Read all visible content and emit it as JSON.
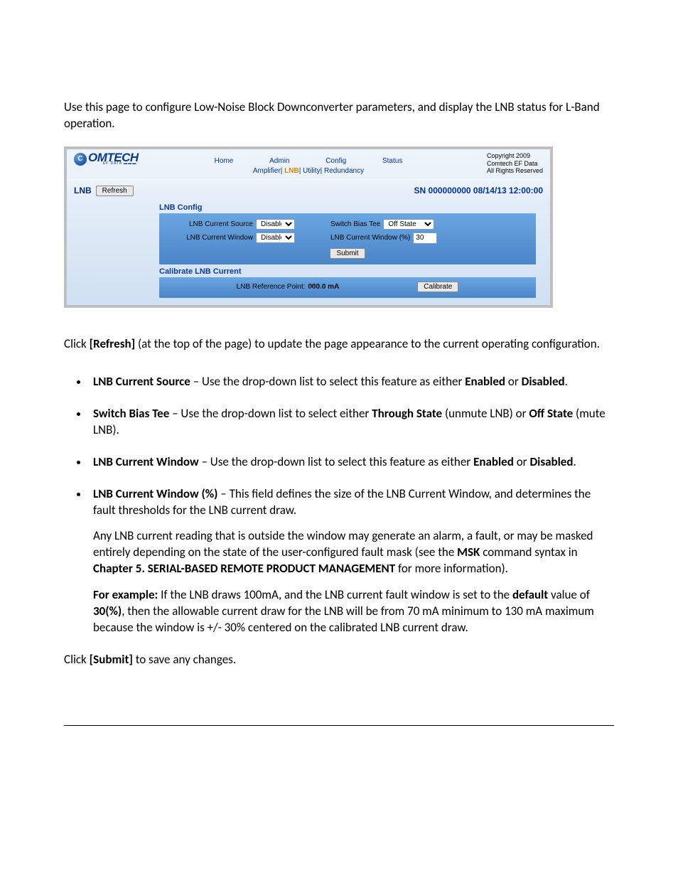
{
  "doc": {
    "intro": "Use this page to configure Low-Noise Block Downconverter parameters, and display the LNB status for L-Band operation.",
    "refresh_p1a": "Click ",
    "refresh_p1b": "[Refresh]",
    "refresh_p1c": " (at the top of the page) to update the page appearance to the current operating configuration.",
    "li1_a": "LNB Current Source",
    "li1_b": " – Use the drop-down list to select this feature as either ",
    "li1_c": "Enabled",
    "li1_d": " or ",
    "li1_e": "Disabled",
    "li2_a": "Switch Bias Tee",
    "li2_b": " – Use the drop-down list to select either ",
    "li2_c": "Through State",
    "li2_d": " (unmute LNB) or ",
    "li2_e": "Off State",
    "li2_f": " (mute LNB).",
    "li3_a": "LNB Current Window",
    "li3_b": " – Use the drop-down list to select this feature as either ",
    "li3_c": "Enabled",
    "li3_d": " or ",
    "li3_e": "Disabled",
    "li4_a": "LNB Current Window (%)",
    "li4_b": " – This field defines the size of the LNB Current Window, and determines the fault thresholds for the LNB current draw.",
    "li4_p2a": "Any LNB current reading that is outside the window may generate an alarm, a fault, or may be masked entirely depending on the state of the user-configured fault mask (see the ",
    "li4_p2b": "MSK",
    "li4_p2c": " command syntax in ",
    "li4_p2d": "Chapter 5. SERIAL-BASED REMOTE PRODUCT MANAGEMENT",
    "li4_p2e": " for more information).",
    "li4_p3a": "For example:",
    "li4_p3b": " If the LNB draws 100mA, and the LNB current fault window is set to the ",
    "li4_p3c": "default",
    "li4_p3d": " value of ",
    "li4_p3e": "30(%)",
    "li4_p3f": ", then the allowable current draw for the LNB will be from 70 mA minimum to 130 mA maximum because the window is +/- 30% centered on the calibrated LNB current draw.",
    "submit_a": "Click ",
    "submit_b": "[Submit]",
    "submit_c": " to save any changes."
  },
  "ss": {
    "logo_main": "OMTECH",
    "logo_sub": "EF DATA ▬▬▬.",
    "nav": {
      "home": "Home",
      "admin": "Admin",
      "config": "Config",
      "status": "Status"
    },
    "subnav": {
      "amp": "Amplifier",
      "lnb": "LNB",
      "util": "Utility",
      "red": "Redundancy",
      "sep": "| "
    },
    "copyright_l1": "Copyright 2009",
    "copyright_l2": "Comtech EF Data",
    "copyright_l3": "All Rights Reserved",
    "lnb_label": "LNB",
    "refresh_btn": "Refresh",
    "sn": "SN 000000000 08/14/13 12:00:00",
    "sect1_title": "LNB Config",
    "f1_label": "LNB Current Source",
    "f1_value": "Disable",
    "f2_label": "Switch Bias Tee",
    "f2_value": "Off State",
    "f3_label": "LNB Current Window",
    "f3_value": "Disable",
    "f4_label": "LNB Current Window (%)",
    "f4_value": "30",
    "submit_btn": "Submit",
    "sect2_title": "Calibrate LNB Current",
    "ref_label": "LNB Reference Point:",
    "ref_value": "000.0 mA",
    "calibrate_btn": "Calibrate"
  }
}
